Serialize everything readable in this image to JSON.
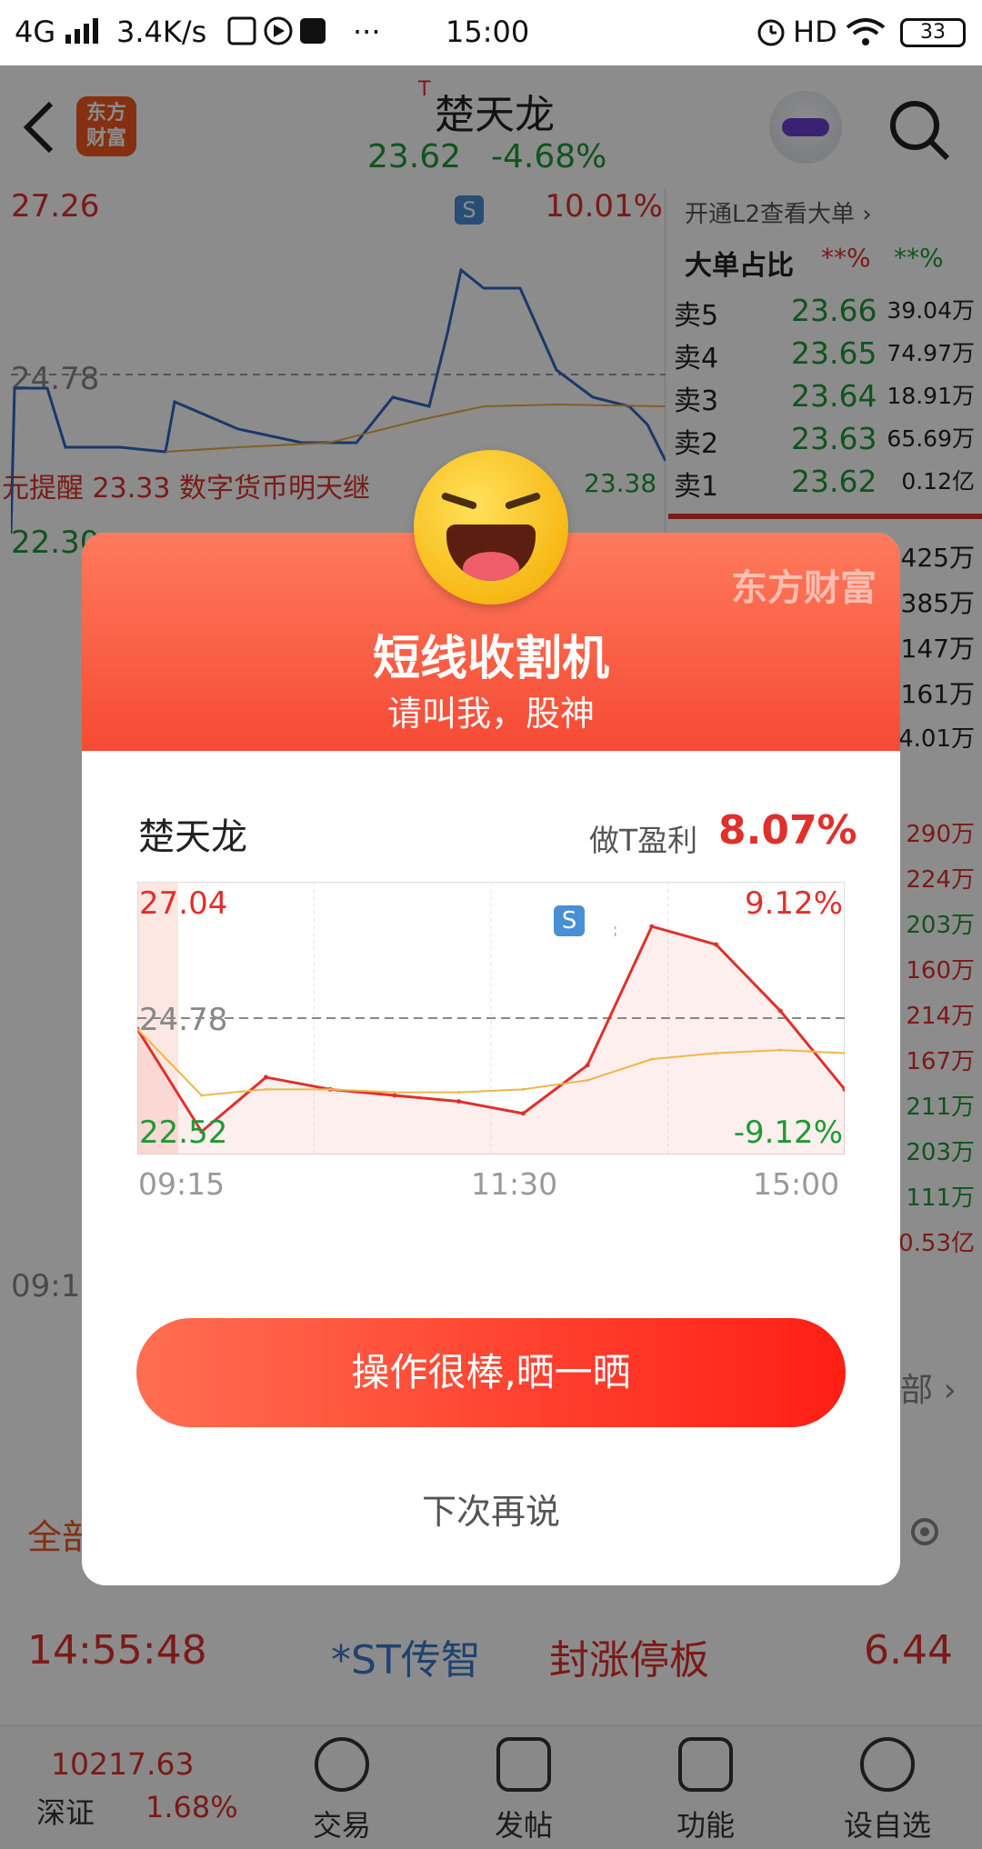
{
  "statusbar": {
    "network": "4G",
    "speed": "3.4K/s",
    "dots": "···",
    "time": "15:00",
    "hd": "HD",
    "battery": "33"
  },
  "header": {
    "stock_prefix": "T",
    "stock_name": "楚天龙",
    "price": "23.62",
    "change": "-4.68%",
    "logo_line1": "东方",
    "logo_line2": "财富"
  },
  "background": {
    "chart_high": "27.26",
    "chart_high_pct": "10.01%",
    "chart_mid": "24.78",
    "chart_low": "22.30",
    "chart_marker": "S",
    "chart_price_label": "23.38",
    "chart_news": "元提醒 23.33  数字货币明天继",
    "time_start": "09:1",
    "side_panel": {
      "open_l2": "开通L2查看大单 ›",
      "big_order": "大单占比",
      "big_order_red": "**%",
      "big_order_green": "**%",
      "asks": [
        {
          "label": "卖5",
          "price": "23.66",
          "vol": "39.04万"
        },
        {
          "label": "卖4",
          "price": "23.65",
          "vol": "74.97万"
        },
        {
          "label": "卖3",
          "price": "23.64",
          "vol": "18.91万"
        },
        {
          "label": "卖2",
          "price": "23.63",
          "vol": "65.69万"
        },
        {
          "label": "卖1",
          "price": "23.62",
          "vol": "0.12亿"
        }
      ],
      "bids_vol": [
        "425万",
        "385万",
        "147万",
        "161万",
        "74.01万"
      ],
      "trades": [
        "290万",
        "224万",
        "203万",
        "160万",
        "214万",
        "167万",
        "211万",
        "203万",
        "111万",
        "0.53亿"
      ]
    },
    "tabs_right": "部 ›",
    "tab_all": "全部",
    "ticker": {
      "time": "14:55:48",
      "name": "*ST传智",
      "event": "封涨停板",
      "price": "6.44"
    },
    "index": {
      "value": "10217.63",
      "name": "深证",
      "change": "1.68%"
    },
    "nav": [
      {
        "label": "交易",
        "icon": "yen-swap-icon"
      },
      {
        "label": "发帖",
        "icon": "compose-icon"
      },
      {
        "label": "功能",
        "icon": "grid-icon"
      },
      {
        "label": "设自选",
        "icon": "more-icon"
      }
    ]
  },
  "modal": {
    "brand": "东方财富",
    "title": "短线收割机",
    "subtitle": "请叫我，股神",
    "stock_name": "楚天龙",
    "profit_label": "做T盈利",
    "profit_value": "8.07%",
    "share_button": "操作很棒,晒一晒",
    "later_button": "下次再说",
    "time_labels": [
      "09:15",
      "11:30",
      "15:00"
    ]
  },
  "chart_data": {
    "type": "line",
    "title": "",
    "ylabel": "",
    "xlabel": "",
    "high_label": "27.04",
    "high_pct_label": "9.12%",
    "mid_label": "24.78",
    "low_label": "22.52",
    "low_pct_label": "-9.12%",
    "sell_marker": "S",
    "ylim": [
      22.52,
      27.04
    ],
    "reference": 24.78,
    "x": [
      "09:15",
      "09:30",
      "10:00",
      "10:30",
      "11:00",
      "11:30",
      "13:00",
      "13:10",
      "13:30",
      "14:00",
      "14:30",
      "15:00"
    ],
    "series": [
      {
        "color": "#e0302b",
        "values": [
          24.6,
          22.9,
          23.8,
          23.6,
          23.5,
          23.4,
          23.2,
          24.0,
          26.3,
          26.0,
          24.9,
          23.6
        ]
      },
      {
        "color": "#f0b64a",
        "values": [
          24.6,
          23.5,
          23.6,
          23.6,
          23.55,
          23.55,
          23.6,
          23.75,
          24.1,
          24.2,
          24.25,
          24.2
        ]
      }
    ],
    "colors": {
      "price": "#e0302b",
      "avg": "#f0b64a",
      "marker": "#4a8fd6"
    }
  }
}
